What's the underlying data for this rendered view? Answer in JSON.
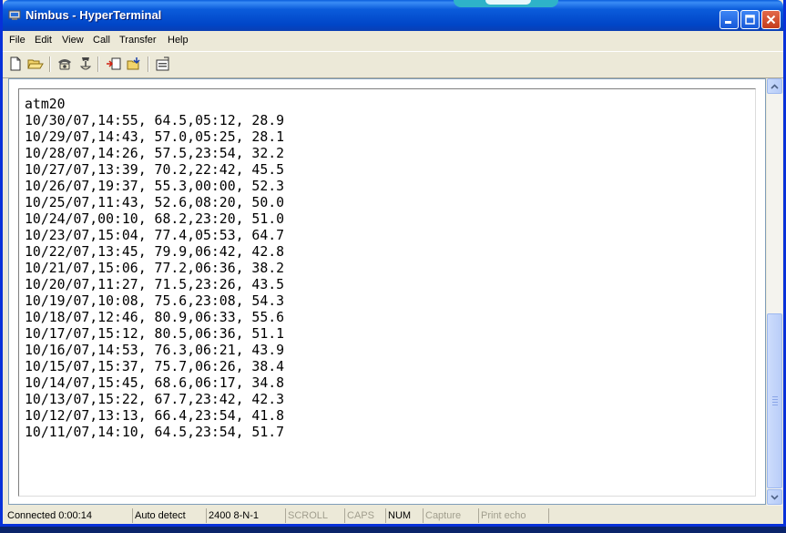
{
  "window": {
    "title": "Nimbus - HyperTerminal"
  },
  "menu": [
    "File",
    "Edit",
    "View",
    "Call",
    "Transfer",
    "Help"
  ],
  "toolbar": {
    "icons": [
      "new-document-icon",
      "open-folder-icon",
      "dial-phone-icon",
      "disconnect-phone-icon",
      "send-file-icon",
      "receive-file-icon",
      "properties-icon"
    ]
  },
  "terminal": {
    "lines": [
      "atm20",
      "10/30/07,14:55, 64.5,05:12, 28.9",
      "10/29/07,14:43, 57.0,05:25, 28.1",
      "10/28/07,14:26, 57.5,23:54, 32.2",
      "10/27/07,13:39, 70.2,22:42, 45.5",
      "10/26/07,19:37, 55.3,00:00, 52.3",
      "10/25/07,11:43, 52.6,08:20, 50.0",
      "10/24/07,00:10, 68.2,23:20, 51.0",
      "10/23/07,15:04, 77.4,05:53, 64.7",
      "10/22/07,13:45, 79.9,06:42, 42.8",
      "10/21/07,15:06, 77.2,06:36, 38.2",
      "10/20/07,11:27, 71.5,23:26, 43.5",
      "10/19/07,10:08, 75.6,23:08, 54.3",
      "10/18/07,12:46, 80.9,06:33, 55.6",
      "10/17/07,15:12, 80.5,06:36, 51.1",
      "10/16/07,14:53, 76.3,06:21, 43.9",
      "10/15/07,15:37, 75.7,06:26, 38.4",
      "10/14/07,15:45, 68.6,06:17, 34.8",
      "10/13/07,15:22, 67.7,23:42, 42.3",
      "10/12/07,13:13, 66.4,23:54, 41.8",
      "10/11/07,14:10, 64.5,23:54, 51.7"
    ]
  },
  "status": {
    "connected": "Connected 0:00:14",
    "detect": "Auto detect",
    "settings": "2400 8-N-1",
    "scroll": "SCROLL",
    "caps": "CAPS",
    "num": "NUM",
    "capture": "Capture",
    "print_echo": "Print echo"
  },
  "colors": {
    "titlebar": "#0054e3",
    "chrome": "#ece9d8",
    "terminal_bg": "#ffffff",
    "close_button": "#d44a2b"
  }
}
